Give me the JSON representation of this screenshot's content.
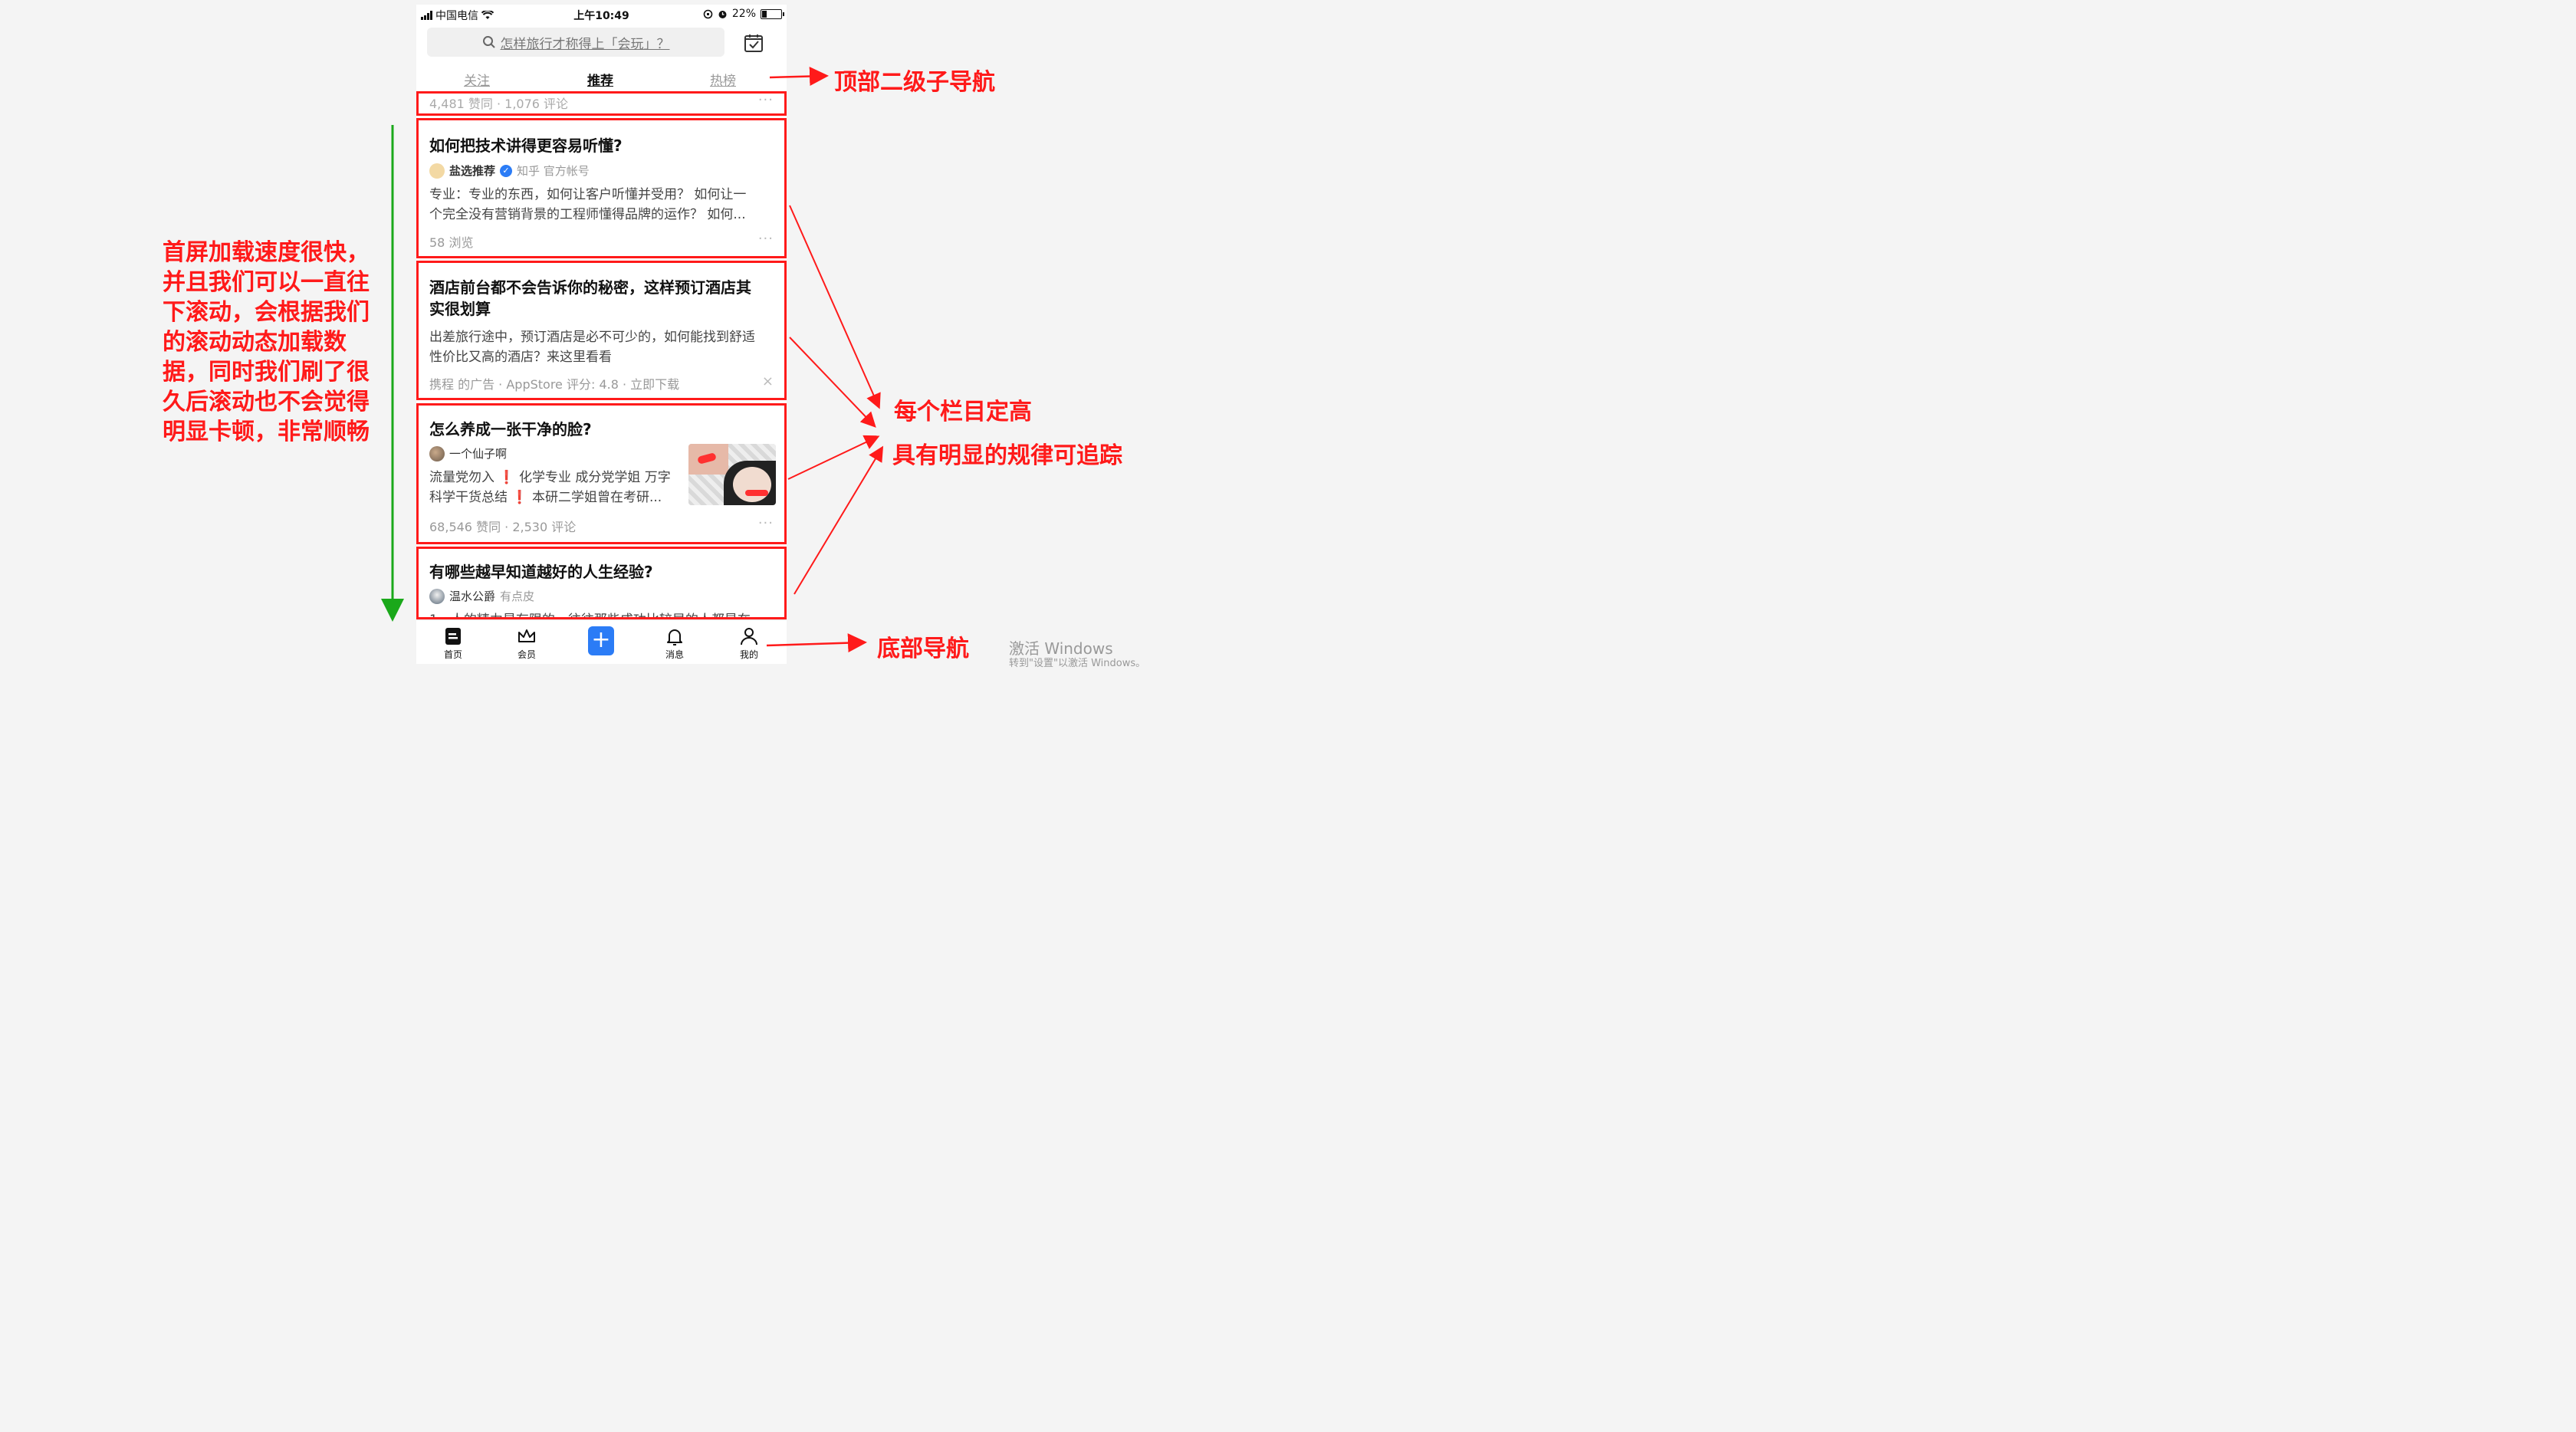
{
  "status_bar": {
    "carrier": "中国电信",
    "time": "上午10:49",
    "battery": "22%"
  },
  "search": {
    "placeholder": "怎样旅行才称得上「会玩」？",
    "icon": "search-icon"
  },
  "tabs": [
    {
      "label": "关注",
      "active": false
    },
    {
      "label": "推荐",
      "active": true
    },
    {
      "label": "热榜",
      "active": false
    }
  ],
  "feed": {
    "partial_top": {
      "meta": "4,481 赞同 · 1,076 评论",
      "more": "···"
    },
    "items": [
      {
        "title": "如何把技术讲得更容易听懂?",
        "author": "盐选推荐",
        "author_badge": "知乎 官方帐号",
        "desc_lines": [
          "专业：专业的东西，如何让客户听懂并受用？ 如何让一",
          "个完全没有营销背景的工程师懂得品牌的运作？ 如何..."
        ],
        "meta": "58 浏览",
        "more": "···"
      },
      {
        "title_lines": [
          "酒店前台都不会告诉你的秘密，这样预订酒店其",
          "实很划算"
        ],
        "desc_lines": [
          "出差旅行途中，预订酒店是必不可少的，如何能找到舒适",
          "性价比又高的酒店？来这里看看"
        ],
        "meta": "携程 的广告 · AppStore 评分: 4.8 · 立即下载",
        "close": "×"
      },
      {
        "title": "怎么养成一张干净的脸?",
        "author": "一个仙子啊",
        "desc_lines": [
          "流量党勿入 ❗ 化学专业 成分党学姐 万字",
          "科学干货总结 ❗ 本研二学姐曾在考研..."
        ],
        "meta": "68,546 赞同 · 2,530 评论",
        "more": "···"
      },
      {
        "title": "有哪些越早知道越好的人生经验?",
        "author": "温水公爵",
        "author_tag": "有点皮",
        "desc_partial": "1、人的精力是有限的，往往那些成功比较早的人都是在"
      }
    ]
  },
  "bottom_nav": [
    {
      "label": "首页",
      "icon": "home-icon"
    },
    {
      "label": "会员",
      "icon": "crown-icon"
    },
    {
      "label": "",
      "icon": "plus-icon"
    },
    {
      "label": "消息",
      "icon": "bell-icon"
    },
    {
      "label": "我的",
      "icon": "user-icon"
    }
  ],
  "annotations": {
    "top_nav": "顶部二级子导航",
    "fixed_height": "每个栏目定高",
    "trackable": "具有明显的规律可追踪",
    "bottom_nav": "底部导航",
    "left_note": "首屏加载速度很快，并且我们可以一直往下滚动，会根据我们的滚动动态加载数据，同时我们刷了很久后滚动也不会觉得明显卡顿，非常顺畅"
  },
  "watermark": {
    "line1": "激活 Windows",
    "line2": "转到\"设置\"以激活 Windows。"
  },
  "colors": {
    "annotation": "#ff1a1a",
    "scroll_arrow": "#1aa81a",
    "accent": "#2b7cf6"
  }
}
